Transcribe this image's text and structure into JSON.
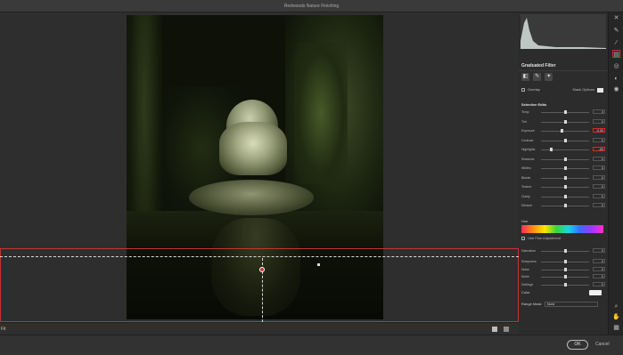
{
  "window": {
    "title": "Redwoods Nature Finishing"
  },
  "canvas": {
    "zoom_label": "Fit"
  },
  "panel": {
    "title": "Graduated Filter",
    "tools": [
      "◧",
      "✎",
      "✦"
    ],
    "overlay": {
      "label": "Overlay",
      "mask_label": "Mask Options"
    },
    "section_title": "Selective Edits",
    "adjustments": [
      {
        "label": "Temp",
        "value": "0",
        "level": 0.5,
        "highlight": false
      },
      {
        "label": "Tint",
        "value": "0",
        "level": 0.5,
        "highlight": false
      },
      {
        "label": "Exposure",
        "value": "-0.50",
        "level": 0.42,
        "highlight": true
      },
      {
        "label": "Contrast",
        "value": "0",
        "level": 0.5,
        "highlight": false
      },
      {
        "label": "Highlights",
        "value": "-60",
        "level": 0.2,
        "highlight": true
      },
      {
        "label": "Shadows",
        "value": "0",
        "level": 0.5,
        "highlight": false
      },
      {
        "label": "Whites",
        "value": "0",
        "level": 0.5,
        "highlight": false
      },
      {
        "label": "Blacks",
        "value": "0",
        "level": 0.5,
        "highlight": false
      },
      {
        "label": "Texture",
        "value": "0",
        "level": 0.5,
        "highlight": false
      },
      {
        "label": "Clarity",
        "value": "0",
        "level": 0.5,
        "highlight": false
      },
      {
        "label": "Dehaze",
        "value": "0",
        "level": 0.5,
        "highlight": false
      }
    ],
    "hue_label": "Hue",
    "fine_label": "Use Fine Adjustment",
    "lower_adjustments": [
      {
        "label": "Sharpness",
        "value": "0",
        "level": 0.5,
        "highlight": false
      },
      {
        "label": "Noise",
        "value": "0",
        "level": 0.5,
        "highlight": false
      },
      {
        "label": "Moire",
        "value": "0",
        "level": 0.5,
        "highlight": false
      },
      {
        "label": "Defringe",
        "value": "0",
        "level": 0.5,
        "highlight": false
      }
    ],
    "saturation_label": "Saturation",
    "saturation_value": "0",
    "color_label": "Color",
    "range_label": "Range Mask",
    "range_value": "None"
  },
  "rail_icons": [
    "close-icon",
    "brush-icon",
    "eyedropper-icon",
    "graduated-filter-icon",
    "radial-filter-icon",
    "adjustment-brush-icon",
    "redeye-icon",
    "zoom-icon",
    "hand-icon",
    "grid-icon"
  ],
  "footer": {
    "ok_label": "OK",
    "cancel_label": "Cancel"
  },
  "colors": {
    "accent": "#c8322d",
    "panel_bg": "#2c2c2c",
    "canvas_bg": "#2e2e2e"
  }
}
